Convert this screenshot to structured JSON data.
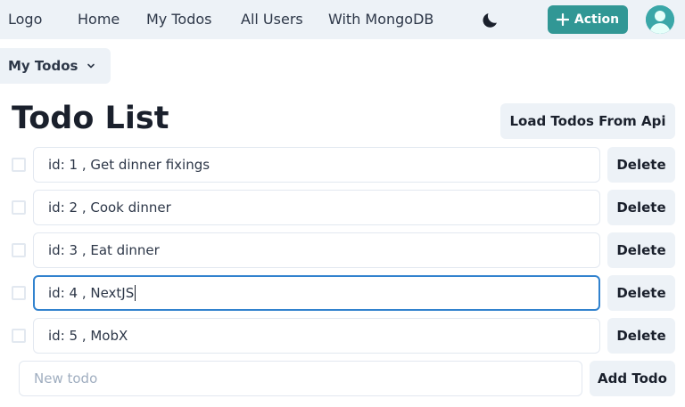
{
  "navbar": {
    "logo": "Logo",
    "links": [
      "Home",
      "My Todos",
      "All Users",
      "With MongoDB"
    ],
    "theme_toggle_icon": "moon-icon",
    "action_label": "Action",
    "action_icon": "plus-icon",
    "accent_color": "#319795",
    "avatar_icon": "user-avatar-icon"
  },
  "subnav": {
    "label": "My Todos",
    "icon": "chevron-down-icon"
  },
  "page": {
    "title": "Todo List",
    "load_button": "Load Todos From Api"
  },
  "todos": [
    {
      "text": "id: 1 , Get dinner fixings",
      "checked": false,
      "delete_label": "Delete"
    },
    {
      "text": "id: 2 , Cook dinner",
      "checked": false,
      "delete_label": "Delete"
    },
    {
      "text": "id: 3 , Eat dinner",
      "checked": false,
      "delete_label": "Delete"
    },
    {
      "text": "id: 4 , NextJS",
      "checked": false,
      "delete_label": "Delete",
      "focused": true
    },
    {
      "text": "id: 5 , MobX",
      "checked": false,
      "delete_label": "Delete"
    }
  ],
  "new_todo": {
    "placeholder": "New todo",
    "add_label": "Add Todo"
  }
}
